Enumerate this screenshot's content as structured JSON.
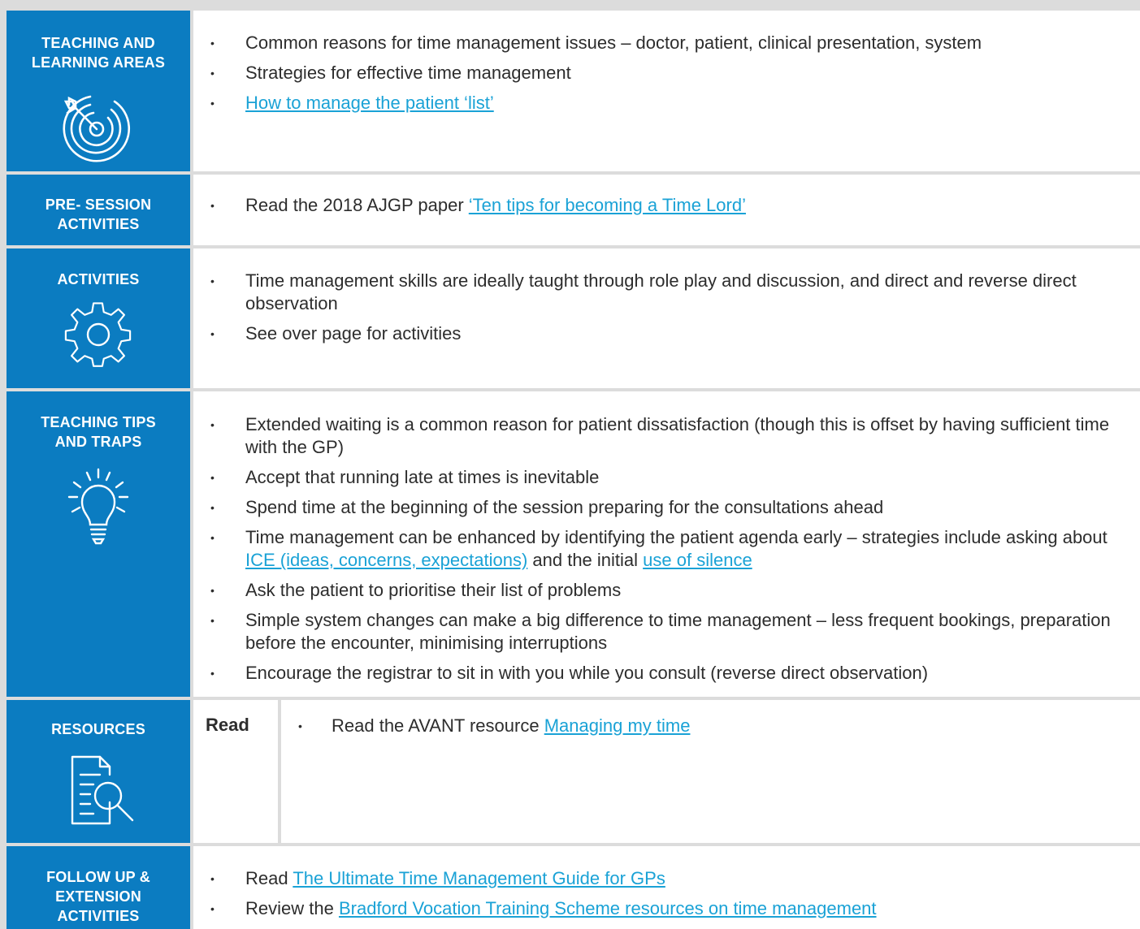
{
  "rows": [
    {
      "label": "TEACHING AND LEARNING AREAS",
      "icon": "target-icon",
      "items": [
        {
          "text": "Common reasons for time management issues – doctor, patient, clinical presentation, system"
        },
        {
          "text": "Strategies for effective time management"
        },
        {
          "link": "How to manage the patient ‘list’"
        }
      ]
    },
    {
      "label": "PRE- SESSION ACTIVITIES",
      "items": [
        {
          "text": "Read the 2018 AJGP paper ",
          "link": "‘Ten tips for becoming a Time Lord’"
        }
      ]
    },
    {
      "label": "ACTIVITIES",
      "icon": "gear-icon",
      "items": [
        {
          "text": "Time management skills are ideally taught through role play and discussion, and direct and reverse direct observation"
        },
        {
          "text": "See over page for activities"
        }
      ]
    },
    {
      "label": "TEACHING TIPS AND TRAPS",
      "icon": "lightbulb-icon",
      "items": [
        {
          "text": "Extended waiting is a common reason for patient dissatisfaction (though this is offset by having sufficient time with the GP)"
        },
        {
          "text": "Accept that running late at times is inevitable"
        },
        {
          "text": "Spend time at the beginning of the session preparing for the consultations ahead"
        },
        {
          "text": "Time management can be enhanced by identifying the patient agenda early – strategies include asking about ",
          "link": "ICE (ideas, concerns, expectations)",
          "text2": " and the initial ",
          "link2": "use of silence"
        },
        {
          "text": "Ask the patient to prioritise their list of problems"
        },
        {
          "text": "Simple system changes can make a big difference to time management – less frequent bookings, preparation before the encounter, minimising interruptions"
        },
        {
          "text": "Encourage the registrar to sit in with you while you consult (reverse direct observation)"
        }
      ]
    },
    {
      "label": "RESOURCES",
      "icon": "document-search-icon",
      "sub_label": "Read",
      "items": [
        {
          "text": "Read the AVANT resource ",
          "link": "Managing my time"
        }
      ]
    },
    {
      "label": "FOLLOW UP & EXTENSION ACTIVITIES",
      "items": [
        {
          "text": "Read ",
          "link": "The Ultimate Time Management Guide for GPs"
        },
        {
          "text": "Review the ",
          "link": "Bradford Vocation Training Scheme resources on time management"
        }
      ]
    }
  ],
  "colors": {
    "label_bg": "#0b7cc1",
    "link": "#1aa2d6",
    "page_bg": "#dcdcdc"
  }
}
